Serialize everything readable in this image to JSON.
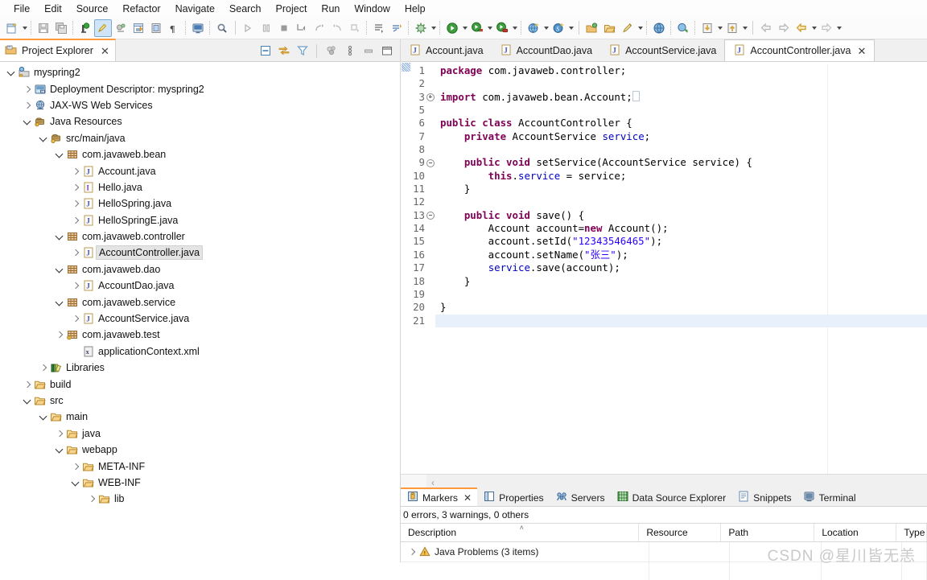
{
  "menubar": {
    "items": [
      {
        "label": "File"
      },
      {
        "label": "Edit"
      },
      {
        "label": "Source"
      },
      {
        "label": "Refactor"
      },
      {
        "label": "Navigate"
      },
      {
        "label": "Search"
      },
      {
        "label": "Project"
      },
      {
        "label": "Run"
      },
      {
        "label": "Window"
      },
      {
        "label": "Help"
      }
    ]
  },
  "toolbar": {
    "items": [
      {
        "name": "new-wizard-icon",
        "dropdown": true
      },
      {
        "name": "save-icon"
      },
      {
        "name": "save-all-icon"
      },
      {
        "name": "new-java-package-icon"
      },
      {
        "name": "toggle-markoccurrences-icon",
        "selected": true
      },
      {
        "name": "link-icon"
      },
      {
        "name": "open-type-icon"
      },
      {
        "name": "open-task-icon"
      },
      {
        "name": "show-whitespace-icon"
      },
      {
        "name": "skip-breakpoints-icon"
      },
      {
        "name": "search-icon"
      },
      {
        "name": "step-over-icon"
      },
      {
        "name": "pause-icon"
      },
      {
        "name": "terminate-icon"
      },
      {
        "name": "step-into-icon"
      },
      {
        "name": "step-return-icon"
      },
      {
        "name": "step-back-icon"
      },
      {
        "name": "drop-to-frame-icon"
      },
      {
        "name": "next-annotation-icon"
      },
      {
        "name": "previous-annotation-icon"
      },
      {
        "name": "debug-config-icon",
        "dropdown": true
      },
      {
        "name": "run-icon",
        "dropdown": true
      },
      {
        "name": "run-as-server-icon",
        "dropdown": true
      },
      {
        "name": "profile-icon",
        "dropdown": true
      },
      {
        "name": "new-web-project-icon",
        "dropdown": true
      },
      {
        "name": "new-spring-icon",
        "dropdown": true
      },
      {
        "name": "open-perspective-icon"
      },
      {
        "name": "open-folder-icon"
      },
      {
        "name": "external-tools-icon",
        "dropdown": true
      },
      {
        "name": "open-web-browser-icon"
      },
      {
        "name": "validate-icon"
      },
      {
        "name": "import-icon",
        "dropdown": true
      },
      {
        "name": "export-icon",
        "dropdown": true
      },
      {
        "name": "back-icon"
      },
      {
        "name": "forward-icon"
      },
      {
        "name": "previous-edit-icon",
        "dropdown": true
      },
      {
        "name": "next-edit-icon",
        "dropdown": true
      }
    ]
  },
  "project_explorer": {
    "title": "Project Explorer",
    "close_label": "✕",
    "tools": [
      {
        "name": "collapse-all-icon"
      },
      {
        "name": "link-with-editor-icon"
      },
      {
        "name": "filter-icon"
      },
      {
        "name": "focus-on-active-task-icon"
      },
      {
        "name": "view-menu-icon"
      },
      {
        "name": "minimize-icon"
      },
      {
        "name": "maximize-icon"
      }
    ],
    "tree": [
      {
        "label": "myspring2",
        "depth": 0,
        "twisty": "down",
        "icon": "dynamic-web-project-icon"
      },
      {
        "label": "Deployment Descriptor: myspring2",
        "depth": 1,
        "twisty": "right",
        "icon": "deployment-descriptor-icon"
      },
      {
        "label": "JAX-WS Web Services",
        "depth": 1,
        "twisty": "right",
        "icon": "web-services-icon"
      },
      {
        "label": "Java Resources",
        "depth": 1,
        "twisty": "down",
        "icon": "java-resources-icon"
      },
      {
        "label": "src/main/java",
        "depth": 2,
        "twisty": "down",
        "icon": "source-folder-icon"
      },
      {
        "label": "com.javaweb.bean",
        "depth": 3,
        "twisty": "down",
        "icon": "package-icon"
      },
      {
        "label": "Account.java",
        "depth": 4,
        "twisty": "right",
        "icon": "java-file-icon"
      },
      {
        "label": "Hello.java",
        "depth": 4,
        "twisty": "right",
        "icon": "java-interface-file-icon"
      },
      {
        "label": "HelloSpring.java",
        "depth": 4,
        "twisty": "right",
        "icon": "java-file-icon"
      },
      {
        "label": "HelloSpringE.java",
        "depth": 4,
        "twisty": "right",
        "icon": "java-file-icon"
      },
      {
        "label": "com.javaweb.controller",
        "depth": 3,
        "twisty": "down",
        "icon": "package-icon"
      },
      {
        "label": "AccountController.java",
        "depth": 4,
        "twisty": "right",
        "icon": "java-file-icon",
        "selected": true
      },
      {
        "label": "com.javaweb.dao",
        "depth": 3,
        "twisty": "down",
        "icon": "package-icon"
      },
      {
        "label": "AccountDao.java",
        "depth": 4,
        "twisty": "right",
        "icon": "java-file-icon"
      },
      {
        "label": "com.javaweb.service",
        "depth": 3,
        "twisty": "down",
        "icon": "package-icon"
      },
      {
        "label": "AccountService.java",
        "depth": 4,
        "twisty": "right",
        "icon": "java-file-icon"
      },
      {
        "label": "com.javaweb.test",
        "depth": 3,
        "twisty": "right",
        "icon": "package-warn-icon"
      },
      {
        "label": "applicationContext.xml",
        "depth": 4,
        "twisty": "none",
        "icon": "xml-file-icon"
      },
      {
        "label": "Libraries",
        "depth": 2,
        "twisty": "right",
        "icon": "libraries-icon"
      },
      {
        "label": "build",
        "depth": 1,
        "twisty": "right",
        "icon": "folder-icon"
      },
      {
        "label": "src",
        "depth": 1,
        "twisty": "down",
        "icon": "folder-icon"
      },
      {
        "label": "main",
        "depth": 2,
        "twisty": "down",
        "icon": "folder-icon"
      },
      {
        "label": "java",
        "depth": 3,
        "twisty": "right",
        "icon": "folder-icon"
      },
      {
        "label": "webapp",
        "depth": 3,
        "twisty": "down",
        "icon": "folder-icon"
      },
      {
        "label": "META-INF",
        "depth": 4,
        "twisty": "right",
        "icon": "folder-icon"
      },
      {
        "label": "WEB-INF",
        "depth": 4,
        "twisty": "down",
        "icon": "folder-icon"
      },
      {
        "label": "lib",
        "depth": 5,
        "twisty": "right",
        "icon": "folder-icon"
      }
    ]
  },
  "editor": {
    "tabs": [
      {
        "label": "Account.java",
        "active": false,
        "icon": "java-file-icon"
      },
      {
        "label": "AccountDao.java",
        "active": false,
        "icon": "java-file-icon"
      },
      {
        "label": "AccountService.java",
        "active": false,
        "icon": "java-file-icon"
      },
      {
        "label": "AccountController.java",
        "active": true,
        "icon": "java-file-icon",
        "close_label": "✕"
      }
    ],
    "scroll_chevron": "‹",
    "lines": [
      {
        "n": "1",
        "fold": "none",
        "cur": false,
        "tokens": [
          {
            "t": "package ",
            "c": "kw"
          },
          {
            "t": "com.javaweb.controller;",
            "c": ""
          }
        ]
      },
      {
        "n": "2",
        "fold": "none",
        "cur": false,
        "tokens": []
      },
      {
        "n": "3",
        "fold": "plus",
        "cur": false,
        "tokens": [
          {
            "t": "import ",
            "c": "kw"
          },
          {
            "t": "com.javaweb.bean.Account;",
            "c": ""
          },
          {
            "t": "▯",
            "c": "box"
          }
        ]
      },
      {
        "n": "5",
        "fold": "none",
        "cur": false,
        "tokens": []
      },
      {
        "n": "6",
        "fold": "none",
        "cur": false,
        "tokens": [
          {
            "t": "public class ",
            "c": "kw"
          },
          {
            "t": "AccountController {",
            "c": ""
          }
        ]
      },
      {
        "n": "7",
        "fold": "none",
        "cur": false,
        "tokens": [
          {
            "t": "    private ",
            "c": "kw"
          },
          {
            "t": "AccountService ",
            "c": ""
          },
          {
            "t": "service",
            "c": "fld"
          },
          {
            "t": ";",
            "c": ""
          }
        ]
      },
      {
        "n": "8",
        "fold": "none",
        "cur": false,
        "tokens": []
      },
      {
        "n": "9",
        "fold": "minus",
        "cur": false,
        "tokens": [
          {
            "t": "    public void ",
            "c": "kw"
          },
          {
            "t": "setService(AccountService service) {",
            "c": ""
          }
        ]
      },
      {
        "n": "10",
        "fold": "none",
        "cur": false,
        "tokens": [
          {
            "t": "        this",
            "c": "kw"
          },
          {
            "t": ".",
            "c": ""
          },
          {
            "t": "service",
            "c": "fld"
          },
          {
            "t": " = service;",
            "c": ""
          }
        ]
      },
      {
        "n": "11",
        "fold": "none",
        "cur": false,
        "tokens": [
          {
            "t": "    }",
            "c": ""
          }
        ]
      },
      {
        "n": "12",
        "fold": "none",
        "cur": false,
        "tokens": []
      },
      {
        "n": "13",
        "fold": "minus",
        "cur": false,
        "tokens": [
          {
            "t": "    public void ",
            "c": "kw"
          },
          {
            "t": "save() {",
            "c": ""
          }
        ]
      },
      {
        "n": "14",
        "fold": "none",
        "cur": false,
        "tokens": [
          {
            "t": "        Account account=",
            "c": ""
          },
          {
            "t": "new ",
            "c": "kw"
          },
          {
            "t": "Account();",
            "c": ""
          }
        ]
      },
      {
        "n": "15",
        "fold": "none",
        "cur": false,
        "tokens": [
          {
            "t": "        account.setId(",
            "c": ""
          },
          {
            "t": "\"12343546465\"",
            "c": "str"
          },
          {
            "t": ");",
            "c": ""
          }
        ]
      },
      {
        "n": "16",
        "fold": "none",
        "cur": false,
        "tokens": [
          {
            "t": "        account.setName(",
            "c": ""
          },
          {
            "t": "\"张三\"",
            "c": "str"
          },
          {
            "t": ");",
            "c": ""
          }
        ]
      },
      {
        "n": "17",
        "fold": "none",
        "cur": false,
        "tokens": [
          {
            "t": "        ",
            "c": ""
          },
          {
            "t": "service",
            "c": "fld"
          },
          {
            "t": ".save(account);",
            "c": ""
          }
        ]
      },
      {
        "n": "18",
        "fold": "none",
        "cur": false,
        "tokens": [
          {
            "t": "    }",
            "c": ""
          }
        ]
      },
      {
        "n": "19",
        "fold": "none",
        "cur": false,
        "tokens": []
      },
      {
        "n": "20",
        "fold": "none",
        "cur": false,
        "tokens": [
          {
            "t": "}",
            "c": ""
          }
        ]
      },
      {
        "n": "21",
        "fold": "none",
        "cur": true,
        "tokens": []
      }
    ]
  },
  "bottom_panel": {
    "tabs": [
      {
        "label": "Markers",
        "active": true,
        "icon": "markers-icon",
        "close_label": "✕"
      },
      {
        "label": "Properties",
        "active": false,
        "icon": "properties-icon"
      },
      {
        "label": "Servers",
        "active": false,
        "icon": "servers-icon"
      },
      {
        "label": "Data Source Explorer",
        "active": false,
        "icon": "data-source-icon"
      },
      {
        "label": "Snippets",
        "active": false,
        "icon": "snippets-icon"
      },
      {
        "label": "Terminal",
        "active": false,
        "icon": "terminal-icon"
      }
    ],
    "status": "0 errors, 3 warnings, 0 others",
    "columns": [
      "Description",
      "Resource",
      "Path",
      "Location",
      "Type"
    ],
    "sort_indicator": "˄",
    "rows": [
      {
        "description": "Java Problems (3 items)",
        "resource": "",
        "path": "",
        "location": "",
        "type": "",
        "icon": "warning-icon",
        "twisty": "right"
      }
    ]
  },
  "watermark": "CSDN @星川皆无恙",
  "colors": {
    "accent_orange": "#ff9a3c",
    "selection_gray": "#e4e4e4",
    "keyword_purple": "#7f0055",
    "string_blue": "#2a00ff",
    "field_blue": "#0000c0",
    "current_line": "#e8f1fb"
  }
}
